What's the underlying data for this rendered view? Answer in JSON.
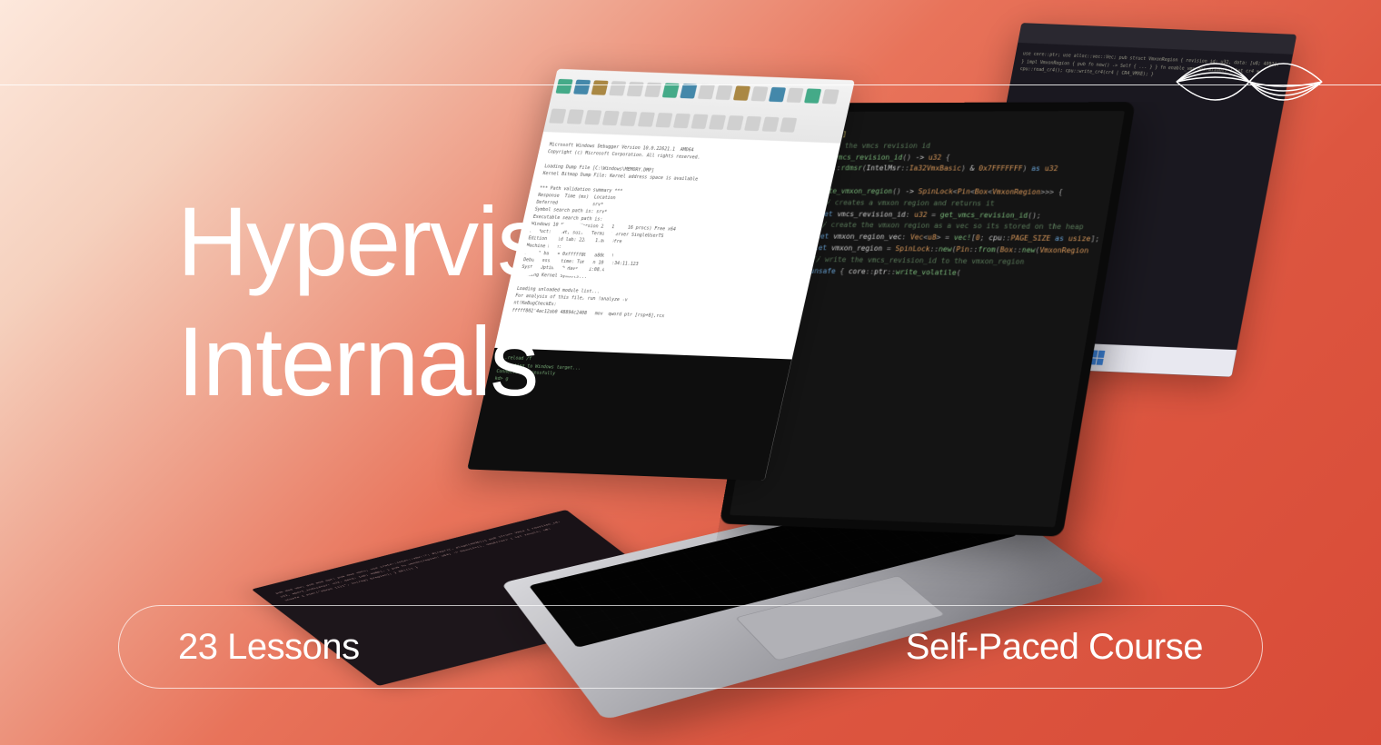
{
  "title_line1": "Hypervisor",
  "title_line2": "Internals",
  "pill": {
    "lessons": "23 Lessons",
    "course_type": "Self-Paced Course"
  },
  "screen_code": "#[inline]\n/// Gets the vmcs revision id\nfn get_vmcs_revision_id() -> u32 {\n   (cpu::rdmsr(IntelMsr::Ia32VmxBasic) & 0x7FFFFFFF) as u32\n\n   create_vmxon_region() -> SpinLock<Pin<Box<VmxonRegion>>> {\n      // creates a vmxon region and returns it\n      let vmcs_revision_id: u32 = get_vmcs_revision_id();\n      // create the vmxon region as a vec so its stored on the heap\n      let vmxon_region_vec: Vec<u8> = vec![0; cpu::PAGE_SIZE as usize];\n      let vmxon_region = SpinLock::new(Pin::from(Box::new(VmxonRegion\n      // write the vmcs_revision_id to the vmxon_region\n      unsafe { core::ptr::write_volatile(",
  "front_window_text": "Microsoft Windows Debugger Version 10.0.22621.1  AMD64\nCopyright (c) Microsoft Corporation. All rights reserved.\n\nLoading Dump File [C:\\Windows\\MEMORY.DMP]\nKernel Bitmap Dump File: Kernel address space is available\n\n*** Path validation summary ***\nResponse  Time (ms)  Location\nDeferred             srv*\nSymbol search path is: srv*\nExecutable search path is:\nWindows 10 Kernel Version 22621 MP (16 procs) Free x64\nProduct: WinNt, suite: TerminalServer SingleUserTS\nEdition build lab: 22621.1.amd64fre\nMachine Name:\nKernel base = 0xfffff802'4a800000\nDebug session time: Tue Jan 10 12:34:11.123\nSystem Uptime: 0 days 2:41:08.442\nLoading Kernel Symbols...\n\nLoading unloaded module list...\nFor analysis of this file, run !analyze -v\nnt!KeBugCheckEx:\nfffff802'4ac12ab0 48894c2408   mov  qword ptr [rsp+8],rcx",
  "front_window_bottom_text": "> .reload /f\nConnecting to Windows target...\nConnected successfully\nkd> g",
  "back_window_text": "use core::ptr;\nuse alloc::vec::Vec;\n\npub struct VmxonRegion {\n    revision_id: u32,\n    data: [u8; 4092],\n}\n\nimpl VmxonRegion {\n    pub fn new() -> Self { ... }\n}\n\nfn enable_vmx_operation() {\n    let cr4 = cpu::read_cr4();\n    cpu::write_cr4(cr4 | CR4_VMXE);\n}",
  "flat_window_text": "pub mod vmx;\npub mod ept;\npub mod vmcs;\n\nuse crate::intel::vmx::*;\n\n#[repr(C, align(4096))]\npub struct Vmcs {\n    revision_id: u32,\n    abort_indicator: u32,\n    data: [u8; 4088],\n}\n\npub fn vmxon(region: u64) -> Result<(), VmxError> {\n    let result: u8;\n    unsafe { asm!(\"vmxon [{}]\", in(reg) &region); }\n    Ok(())\n}"
}
